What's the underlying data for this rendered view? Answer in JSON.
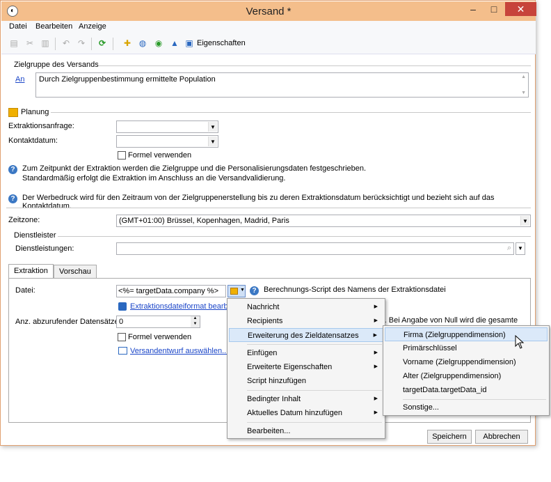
{
  "window": {
    "title": "Versand *",
    "minimize": "–",
    "maximize": "□",
    "close": "✕"
  },
  "menu": [
    "Datei",
    "Bearbeiten",
    "Anzeige"
  ],
  "toolbar": {
    "properties_label": "Eigenschaften"
  },
  "target": {
    "group_title": "Zielgruppe des Versands",
    "link": "An",
    "value": "Durch Zielgruppenbestimmung ermittelte Population"
  },
  "planning": {
    "title": "Planung",
    "extraction_label": "Extraktionsanfrage:",
    "contact_label": "Kontaktdatum:",
    "formula_label": "Formel verwenden",
    "info1_line1": "Zum Zeitpunkt der Extraktion werden die Zielgruppe und die Personalisierungsdaten festgeschrieben.",
    "info1_line2": "Standardmäßig erfolgt die Extraktion im Anschluss an die Versandvalidierung.",
    "info2": "Der Werbedruck wird für den Zeitraum von der Zielgruppenerstellung bis zu deren Extraktionsdatum berücksichtigt und bezieht sich auf das Kontaktdatum."
  },
  "timezone": {
    "label": "Zeitzone:",
    "value": "(GMT+01:00) Brüssel, Kopenhagen, Madrid, Paris"
  },
  "provider": {
    "group_title": "Dienstleister",
    "services_label": "Dienstleistungen:"
  },
  "tabs": [
    "Extraktion",
    "Vorschau"
  ],
  "extraction": {
    "file_label": "Datei:",
    "file_value": "<%= targetData.company %>",
    "file_info": "Berechnungs-Script des Namens der Extraktionsdatei",
    "format_link": "Extraktionsdateiformat bearbe",
    "count_label": "Anz. abzurufender Datensätze:",
    "count_value": "0",
    "count_info_tail": "ion. Bei Angabe von Null wird die gesamte",
    "formula_label": "Formel verwenden",
    "draft_link": "Versandentwurf auswählen..."
  },
  "buttons": {
    "save": "Speichern",
    "cancel": "Abbrechen"
  },
  "context_menu": [
    "Nachricht",
    "Recipients",
    "Erweiterung des Zieldatensatzes",
    "Einfügen",
    "Erweiterte Eigenschaften",
    "Script hinzufügen",
    "Bedingter Inhalt",
    "Aktuelles Datum hinzufügen",
    "Bearbeiten..."
  ],
  "submenu": [
    "Firma (Zielgruppendimension)",
    "Primärschlüssel",
    "Vorname (Zielgruppendimension)",
    "Alter (Zielgruppendimension)",
    "targetData.targetData_id",
    "Sonstige..."
  ]
}
